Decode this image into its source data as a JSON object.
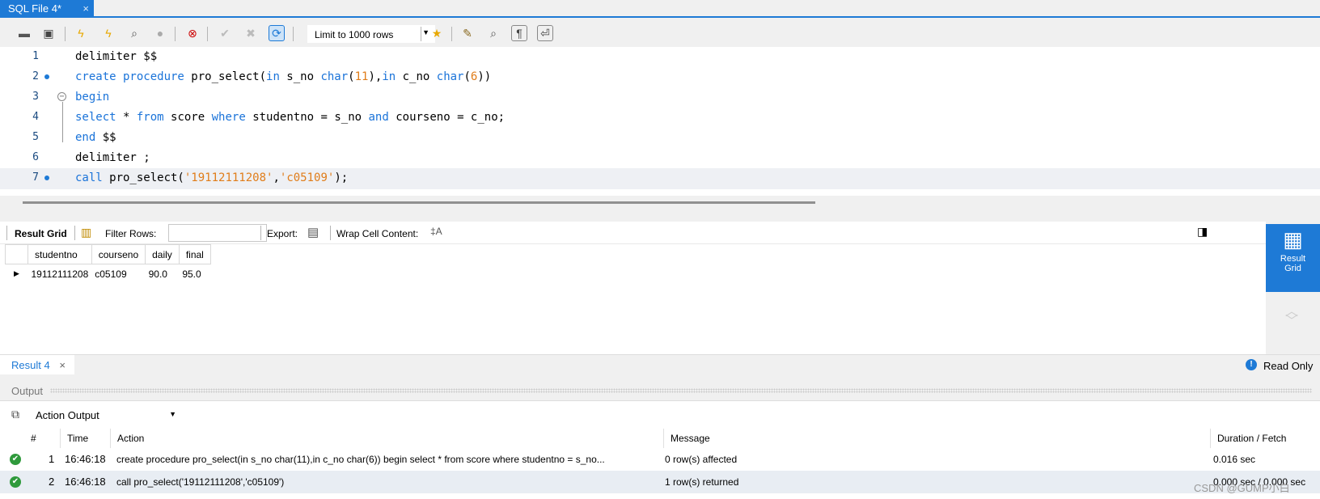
{
  "tab": {
    "title": "SQL File 4*",
    "close": "×"
  },
  "toolbar": {
    "limit": "Limit to 1000 rows"
  },
  "editor": {
    "lines": [
      {
        "n": "1",
        "text": "delimiter $$"
      },
      {
        "n": "2",
        "text": "create procedure pro_select(in s_no char(11),in c_no char(6))"
      },
      {
        "n": "3",
        "text": "begin"
      },
      {
        "n": "4",
        "text": "select * from score where studentno = s_no and courseno = c_no;"
      },
      {
        "n": "5",
        "text": "end $$"
      },
      {
        "n": "6",
        "text": "delimiter ;"
      },
      {
        "n": "7",
        "text": "call pro_select('19112111208','c05109');"
      }
    ]
  },
  "result_toolbar": {
    "result_grid": "Result Grid",
    "filter_rows": "Filter Rows:",
    "export": "Export:",
    "wrap": "Wrap Cell Content:"
  },
  "grid": {
    "columns": [
      "studentno",
      "courseno",
      "daily",
      "final"
    ],
    "rows": [
      [
        "19112111208",
        "c05109",
        "90.0",
        "95.0"
      ]
    ]
  },
  "side": {
    "result_grid_line1": "Result",
    "result_grid_line2": "Grid"
  },
  "result_tab": {
    "label": "Result 4",
    "close": "×",
    "read_only": "Read Only"
  },
  "output": {
    "title": "Output",
    "dropdown": "Action Output",
    "headers": [
      "#",
      "Time",
      "Action",
      "Message",
      "Duration / Fetch"
    ],
    "rows": [
      {
        "num": "1",
        "time": "16:46:18",
        "action": "create procedure pro_select(in s_no char(11),in c_no char(6)) begin select * from score where studentno = s_no...",
        "message": "0 row(s) affected",
        "duration": "0.016 sec"
      },
      {
        "num": "2",
        "time": "16:46:18",
        "action": "call pro_select('19112111208','c05109')",
        "message": "1 row(s) returned",
        "duration": "0.000 sec / 0.000 sec"
      }
    ]
  },
  "watermark": "CSDN @GUMP小白"
}
